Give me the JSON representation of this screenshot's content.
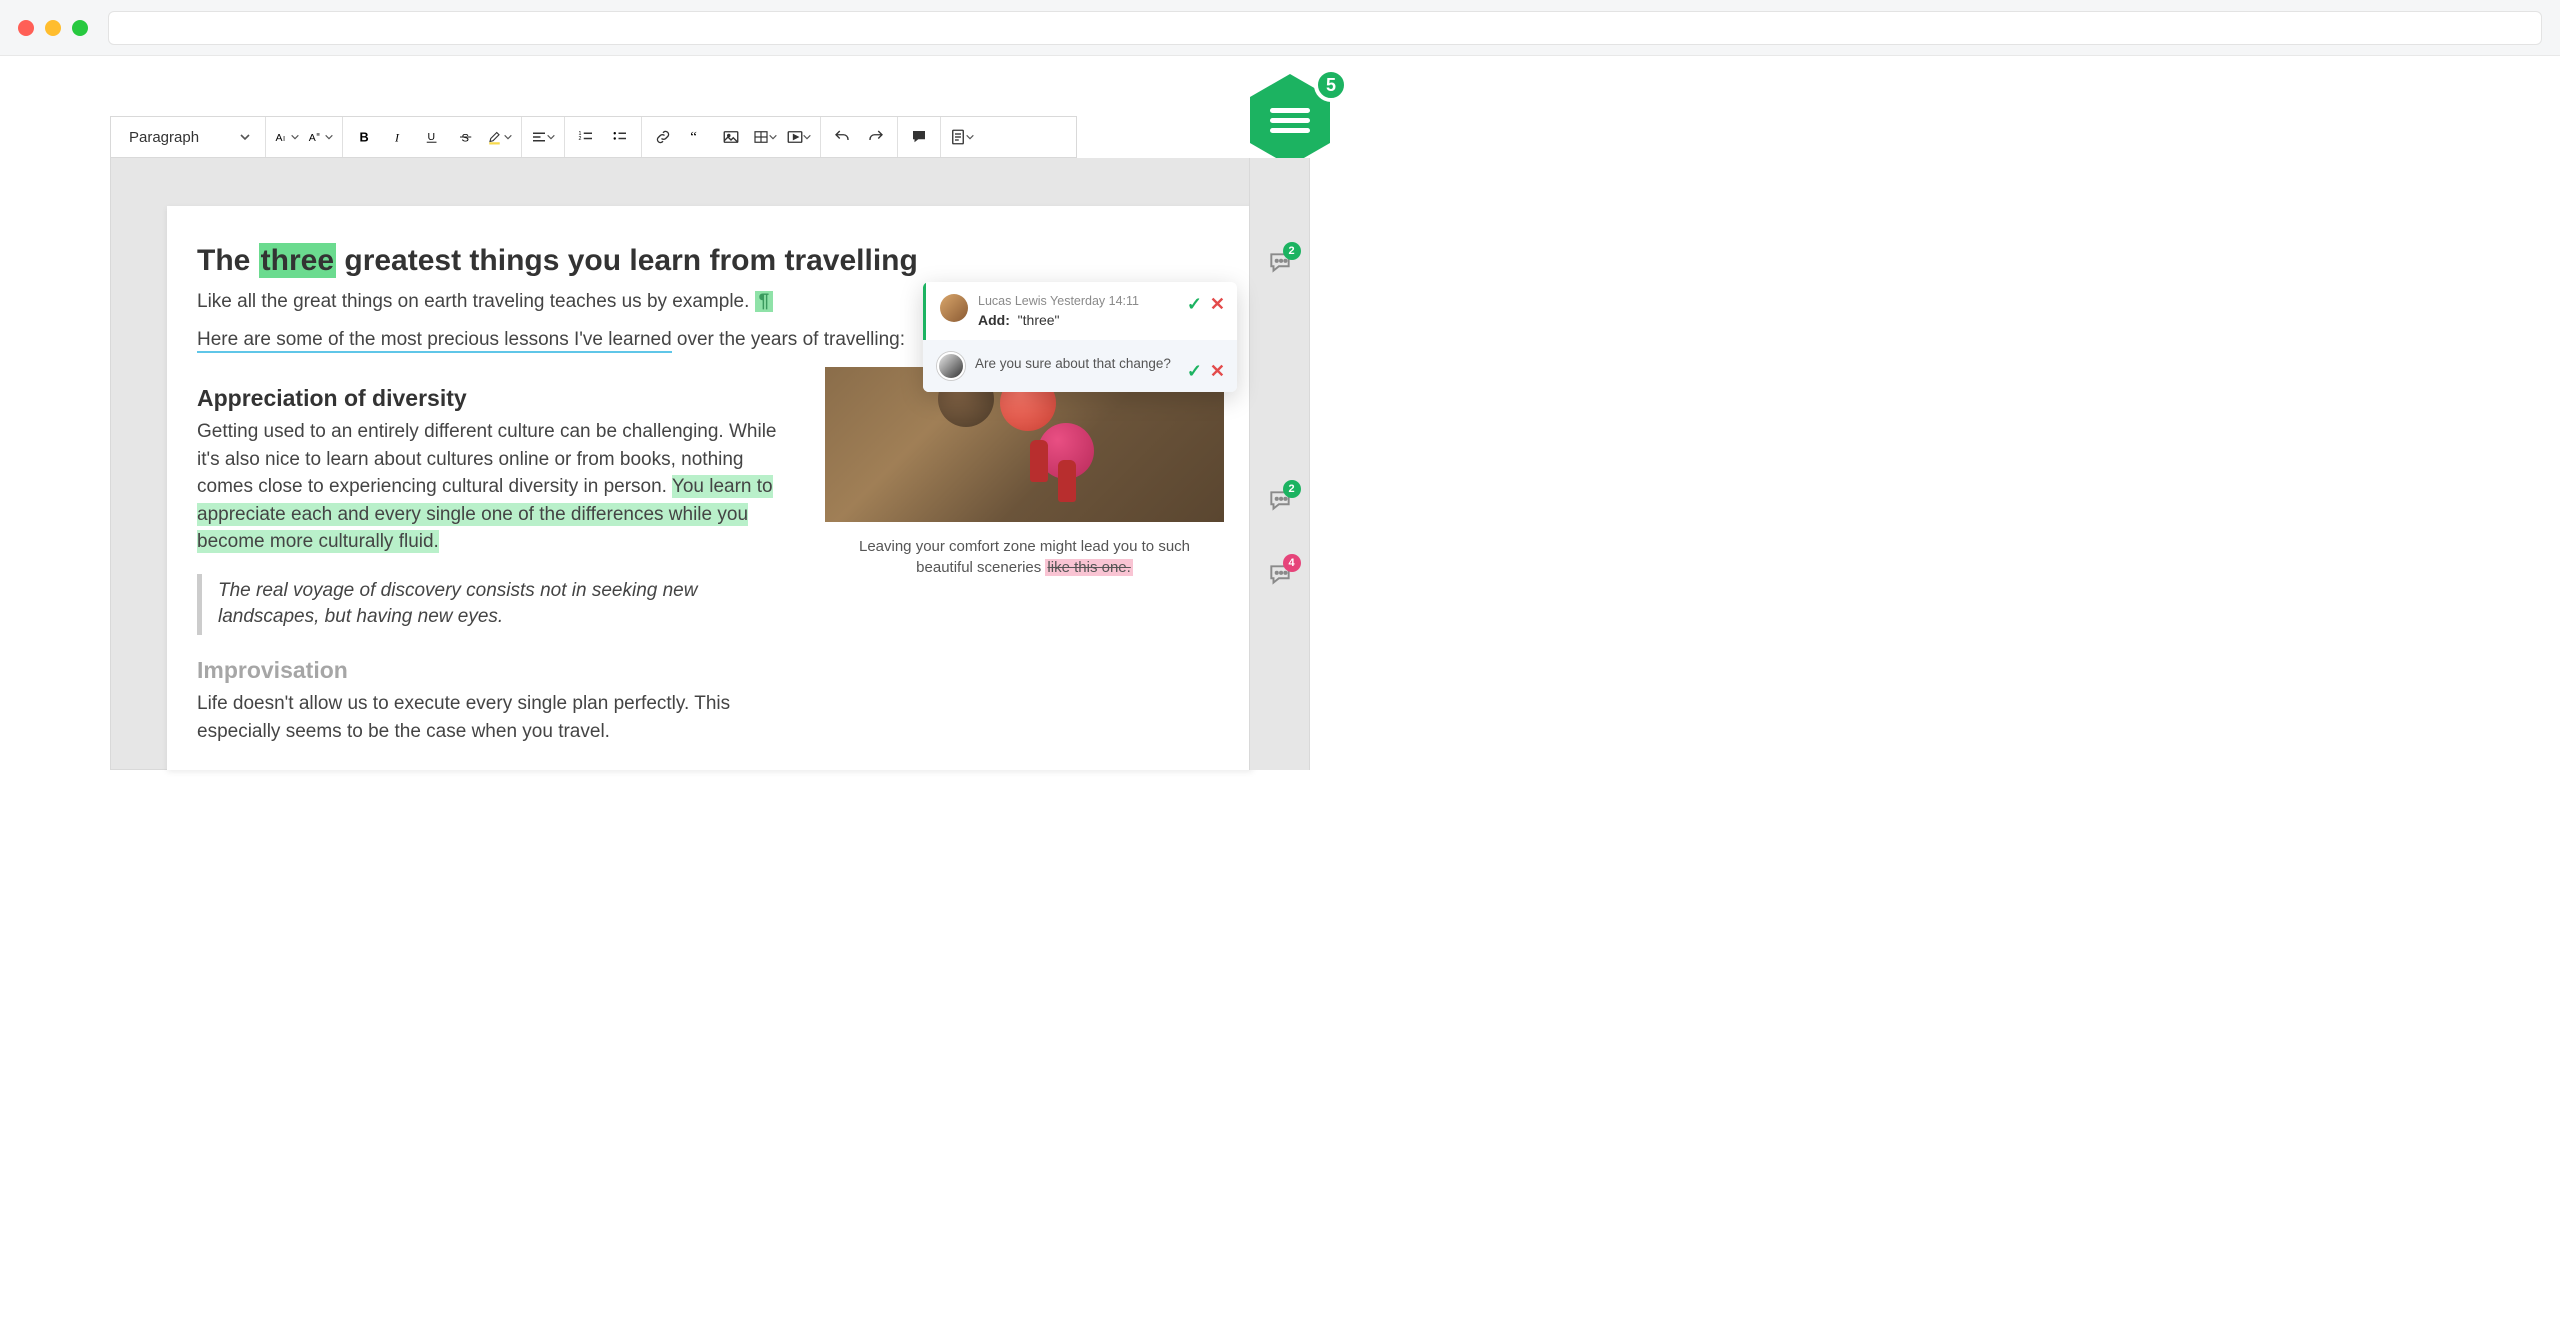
{
  "toolbar": {
    "style_label": "Paragraph"
  },
  "hex": {
    "count": "5"
  },
  "rail": {
    "badge1": "2",
    "badge2": "2",
    "badge3": "4"
  },
  "popover": {
    "meta_name": "Lucas Lewis",
    "meta_time": "Yesterday 14:11",
    "action_label": "Add:",
    "action_value": "\"three\"",
    "reply_text": "Are you sure about that change?"
  },
  "doc": {
    "h1_pre": "The ",
    "h1_mark": "three",
    "h1_post": " greatest things you learn from travelling",
    "p1_pre": "Like all the great things on earth traveling teaches us by example. ",
    "pilcrow": "¶",
    "p2_u": "Here are some of the most precious lessons I've learned",
    "p2_post": " over the years of travelling:",
    "h2a": "Appreciation of diversity",
    "pa": "Getting used to an entirely different culture can be challenging. While it's also nice to learn about cultures online or from books, nothing comes close to experiencing cultural diversity in person. ",
    "pa_hl": "You learn to appreciate each and every single one of the differences while you become more culturally fluid.",
    "quote": "The real voyage of discovery consists not in seeking new landscapes, but having new eyes.",
    "h2b": "Improvisation",
    "pb": "Life doesn't allow us to execute every single plan perfectly. This especially seems to be the case when you travel.",
    "caption_pre": "Leaving your comfort zone might lead you to such beautiful sceneries ",
    "caption_strike": "like this one."
  }
}
